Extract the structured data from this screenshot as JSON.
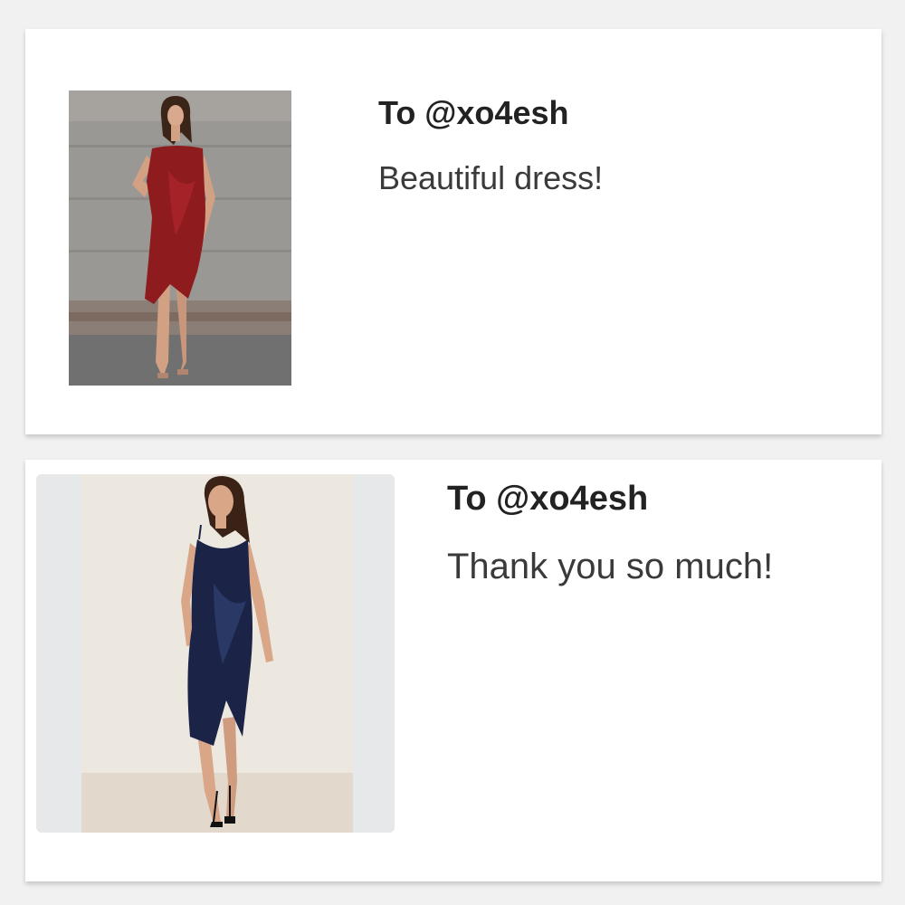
{
  "messages": [
    {
      "recipient": "To @xo4esh",
      "text": "Beautiful dress!",
      "image": "woman-in-red-velvet-wrap-dress"
    },
    {
      "recipient": "To @xo4esh",
      "text": "Thank you so much!",
      "image": "woman-in-navy-velvet-wrap-dress"
    }
  ],
  "colors": {
    "background": "#f1f1f1",
    "card": "#ffffff",
    "recipient_text": "#222222",
    "message_text": "#3a3a3a",
    "red_dress": "#8e1b1e",
    "navy_dress": "#1b2447"
  }
}
